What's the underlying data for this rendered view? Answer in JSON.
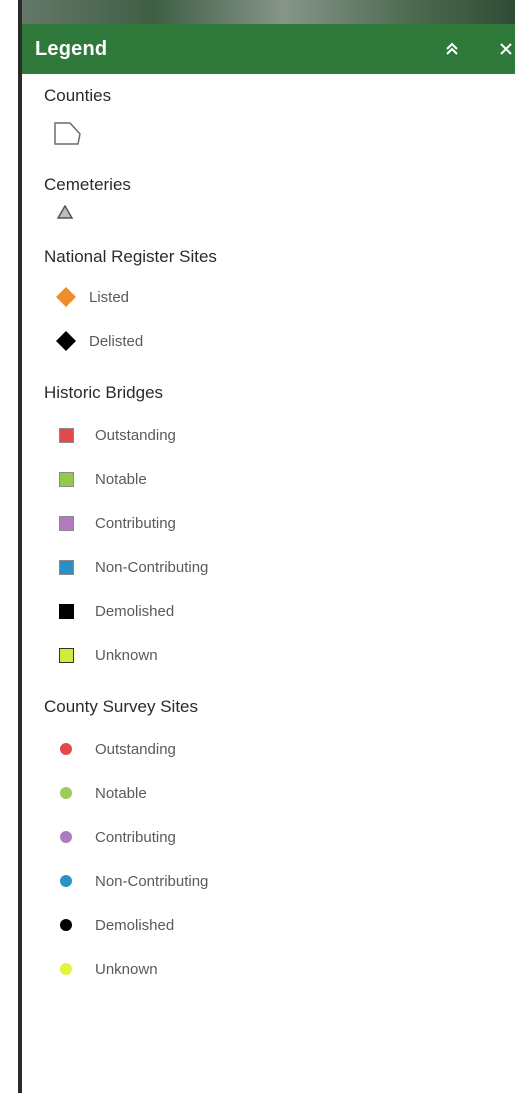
{
  "panel": {
    "title": "Legend"
  },
  "layers": [
    {
      "title": "Counties",
      "items": []
    },
    {
      "title": "Cemeteries",
      "items": []
    },
    {
      "title": "National Register Sites",
      "items": [
        {
          "label": "Listed",
          "color": "#ef8d2a"
        },
        {
          "label": "Delisted",
          "color": "#000000"
        }
      ]
    },
    {
      "title": "Historic Bridges",
      "items": [
        {
          "label": "Outstanding",
          "color": "#e24a4a"
        },
        {
          "label": "Notable",
          "color": "#8fcc4e"
        },
        {
          "label": "Contributing",
          "color": "#b27ac1"
        },
        {
          "label": "Non-Contributing",
          "color": "#2a8fc5"
        },
        {
          "label": "Demolished",
          "color": "#000000"
        },
        {
          "label": "Unknown",
          "color": "#d4ea3a"
        }
      ]
    },
    {
      "title": "County Survey Sites",
      "items": [
        {
          "label": "Outstanding",
          "color": "#e24a4a"
        },
        {
          "label": "Notable",
          "color": "#9ccc5a"
        },
        {
          "label": "Contributing",
          "color": "#ab7dc0"
        },
        {
          "label": "Non-Contributing",
          "color": "#2a93c8"
        },
        {
          "label": "Demolished",
          "color": "#000000"
        },
        {
          "label": "Unknown",
          "color": "#e4f23c"
        }
      ]
    }
  ]
}
